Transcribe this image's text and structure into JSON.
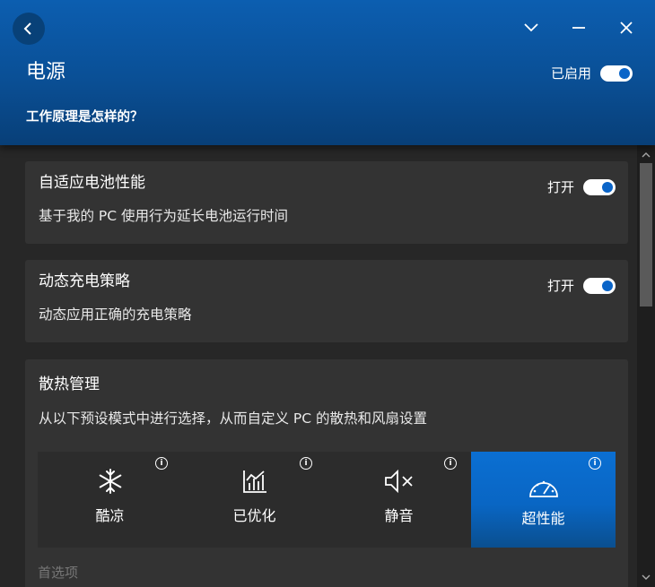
{
  "window": {
    "title": "电源",
    "how_it_works": "工作原理是怎样的？",
    "enabled_label": "已启用",
    "enabled_on": true
  },
  "cards": [
    {
      "title": "自适应电池性能",
      "description": "基于我的 PC 使用行为延长电池运行时间",
      "switch_label": "打开",
      "on": true
    },
    {
      "title": "动态充电策略",
      "description": "动态应用正确的充电策略",
      "switch_label": "打开",
      "on": true
    },
    {
      "title": "散热管理",
      "description": "从以下预设模式中进行选择，从而自定义 PC 的散热和风扇设置"
    }
  ],
  "thermal_modes": [
    {
      "label": "酷凉",
      "icon": "snowflake-icon",
      "selected": false
    },
    {
      "label": "已优化",
      "icon": "chart-icon",
      "selected": false
    },
    {
      "label": "静音",
      "icon": "mute-icon",
      "selected": false
    },
    {
      "label": "超性能",
      "icon": "speedometer-icon",
      "selected": true
    }
  ],
  "info_glyph": "i",
  "preferences_label": "首选项",
  "colors": {
    "header": "#0a4f95",
    "accent": "#0a64c8",
    "card": "#333333",
    "background": "#272727"
  }
}
